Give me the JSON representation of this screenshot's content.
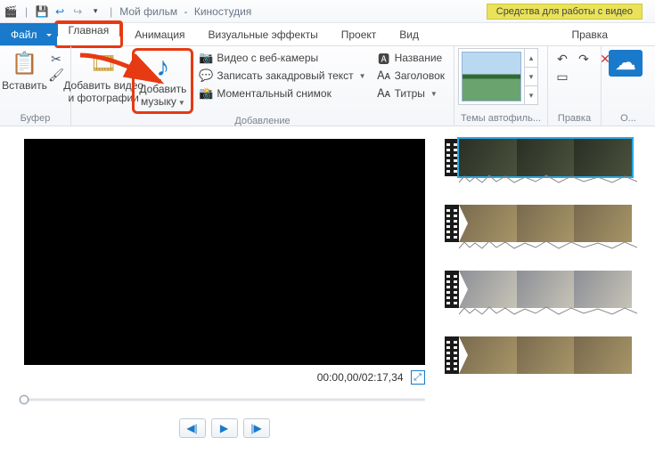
{
  "title": {
    "project": "Мой фильм",
    "app": "Киностудия"
  },
  "context_tab": "Средства для работы с видео",
  "tabs": {
    "file": "Файл",
    "items": [
      {
        "label": "Главная",
        "active": true
      },
      {
        "label": "Анимация"
      },
      {
        "label": "Визуальные эффекты"
      },
      {
        "label": "Проект"
      },
      {
        "label": "Вид"
      }
    ],
    "context_items": [
      {
        "label": "Правка"
      }
    ]
  },
  "ribbon": {
    "groups": {
      "buffer": {
        "label": "Буфер",
        "paste": "Вставить"
      },
      "add": {
        "label": "Добавление",
        "add_media": "Добавить видео\nи фотографии",
        "add_music": "Добавить\nмузыку",
        "webcam": "Видео с веб-камеры",
        "voice": "Записать закадровый текст",
        "snapshot": "Моментальный снимок",
        "title": "Название",
        "header": "Заголовок",
        "caption": "Титры"
      },
      "themes": {
        "label": "Темы автофиль..."
      },
      "edit": {
        "label": "Правка"
      },
      "overflow": "О..."
    }
  },
  "preview": {
    "time": "00:00,00/02:17,34"
  },
  "icons": {
    "save": "💾",
    "undo": "↩",
    "redo": "↪",
    "paste": "📋",
    "cut": "✂",
    "brush": "🖌",
    "media": "🎞",
    "music": "♪",
    "webcam": "📷",
    "mic": "💬",
    "snap": "📸",
    "ttl": "🅰",
    "hdr": "🗛",
    "cap": "🗛",
    "rotL": "↶",
    "rotR": "↷",
    "del": "✕",
    "sel": "▭",
    "cloud": "☁",
    "play": "▶",
    "prev": "◀",
    "next": "▶",
    "fs": "⤢",
    "up": "▴",
    "down": "▾",
    "more": "▾"
  }
}
